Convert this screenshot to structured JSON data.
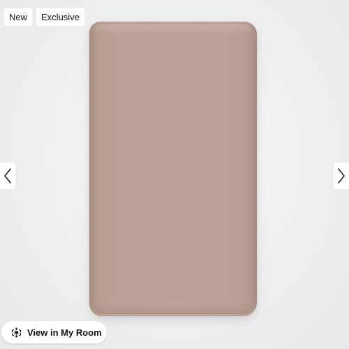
{
  "badges": [
    "New",
    "Exclusive"
  ],
  "product": {
    "image": "fitted-crib-sheet-image",
    "color": "#bda397"
  },
  "nav": {
    "prev_icon": "chevron-left-icon",
    "next_icon": "chevron-right-icon"
  },
  "view_in_room": {
    "label": "View in My Room",
    "icon": "ar-cube-icon"
  }
}
